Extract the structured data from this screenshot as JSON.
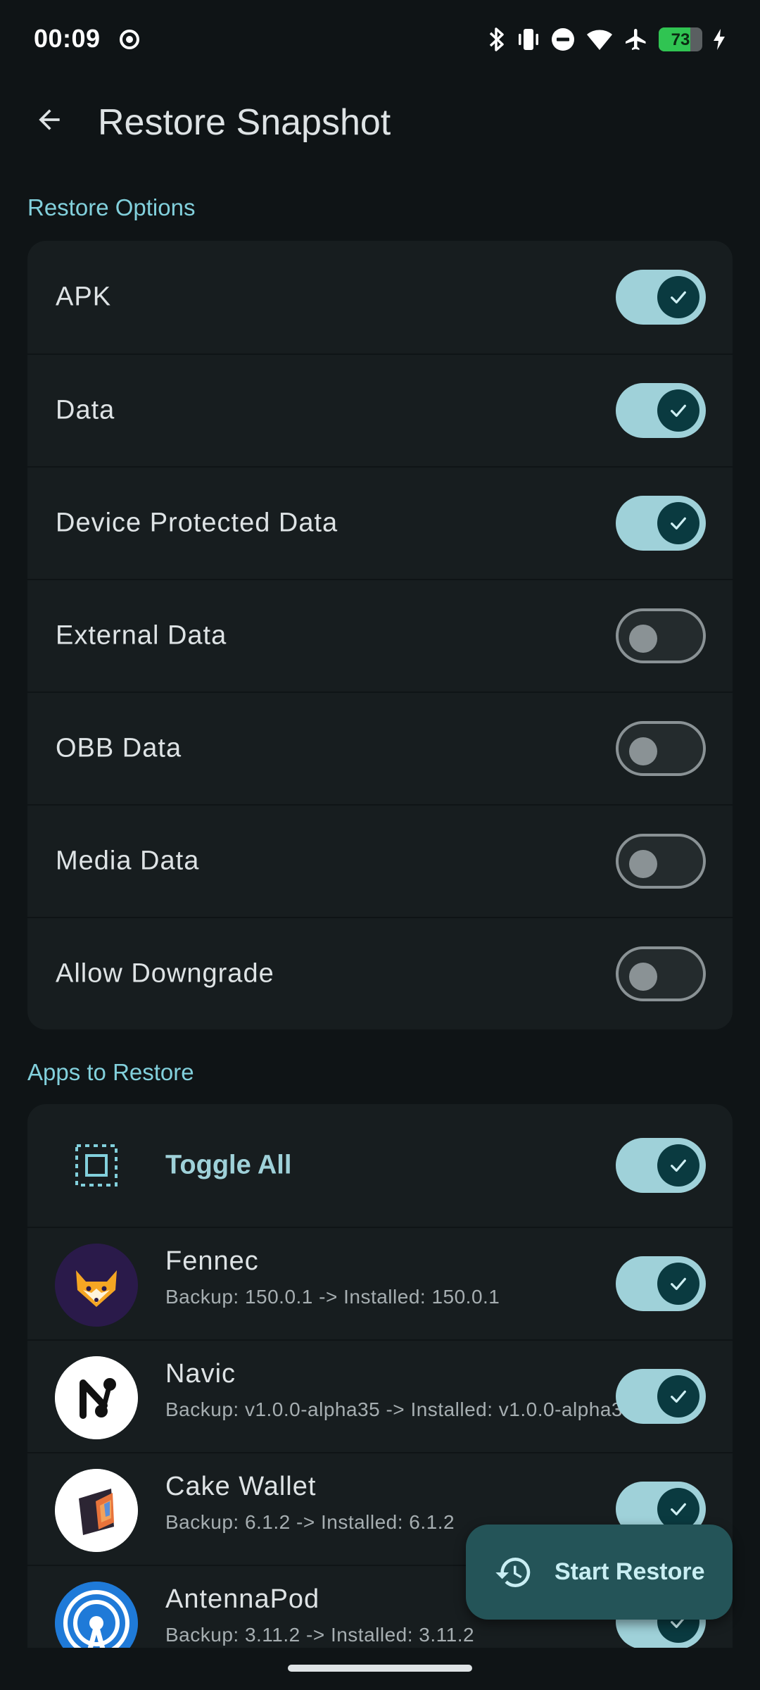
{
  "status_bar": {
    "time": "00:09",
    "battery_level": "73",
    "icons": [
      "record-icon",
      "bluetooth-icon",
      "vibrate-icon",
      "dnd-icon",
      "wifi-icon",
      "airplane-icon",
      "battery-icon",
      "charging-icon"
    ]
  },
  "app_bar": {
    "title": "Restore Snapshot",
    "back_icon": "arrow-back-icon"
  },
  "restore_options": {
    "section_label": "Restore Options",
    "options": [
      {
        "label": "APK",
        "enabled": true
      },
      {
        "label": "Data",
        "enabled": true
      },
      {
        "label": "Device Protected Data",
        "enabled": true
      },
      {
        "label": "External Data",
        "enabled": false
      },
      {
        "label": "OBB Data",
        "enabled": false
      },
      {
        "label": "Media Data",
        "enabled": false
      },
      {
        "label": "Allow Downgrade",
        "enabled": false
      }
    ]
  },
  "apps": {
    "section_label": "Apps to Restore",
    "toggle_all": {
      "label": "Toggle All",
      "enabled": true,
      "icon": "select-all-icon"
    },
    "items": [
      {
        "name": "Fennec",
        "detail": "Backup: 150.0.1 -> Installed: 150.0.1",
        "enabled": true,
        "icon": "fennec-fox-icon"
      },
      {
        "name": "Navic",
        "detail": "Backup: v1.0.0-alpha35 -> Installed: v1.0.0-alpha35",
        "enabled": true,
        "icon": "navic-icon"
      },
      {
        "name": "Cake Wallet",
        "detail": "Backup: 6.1.2 -> Installed: 6.1.2",
        "enabled": true,
        "icon": "cake-wallet-icon"
      },
      {
        "name": "AntennaPod",
        "detail": "Backup: 3.11.2 -> Installed: 3.11.2",
        "enabled": true,
        "icon": "antennapod-icon"
      }
    ]
  },
  "fab": {
    "label": "Start Restore",
    "icon": "history-icon"
  },
  "colors": {
    "background": "#0f1416",
    "surface": "#171d1f",
    "accent": "#82d0dc",
    "switch_on_track": "#9fd1d9",
    "switch_on_thumb": "#0a3a40",
    "fab_background": "#245458"
  }
}
